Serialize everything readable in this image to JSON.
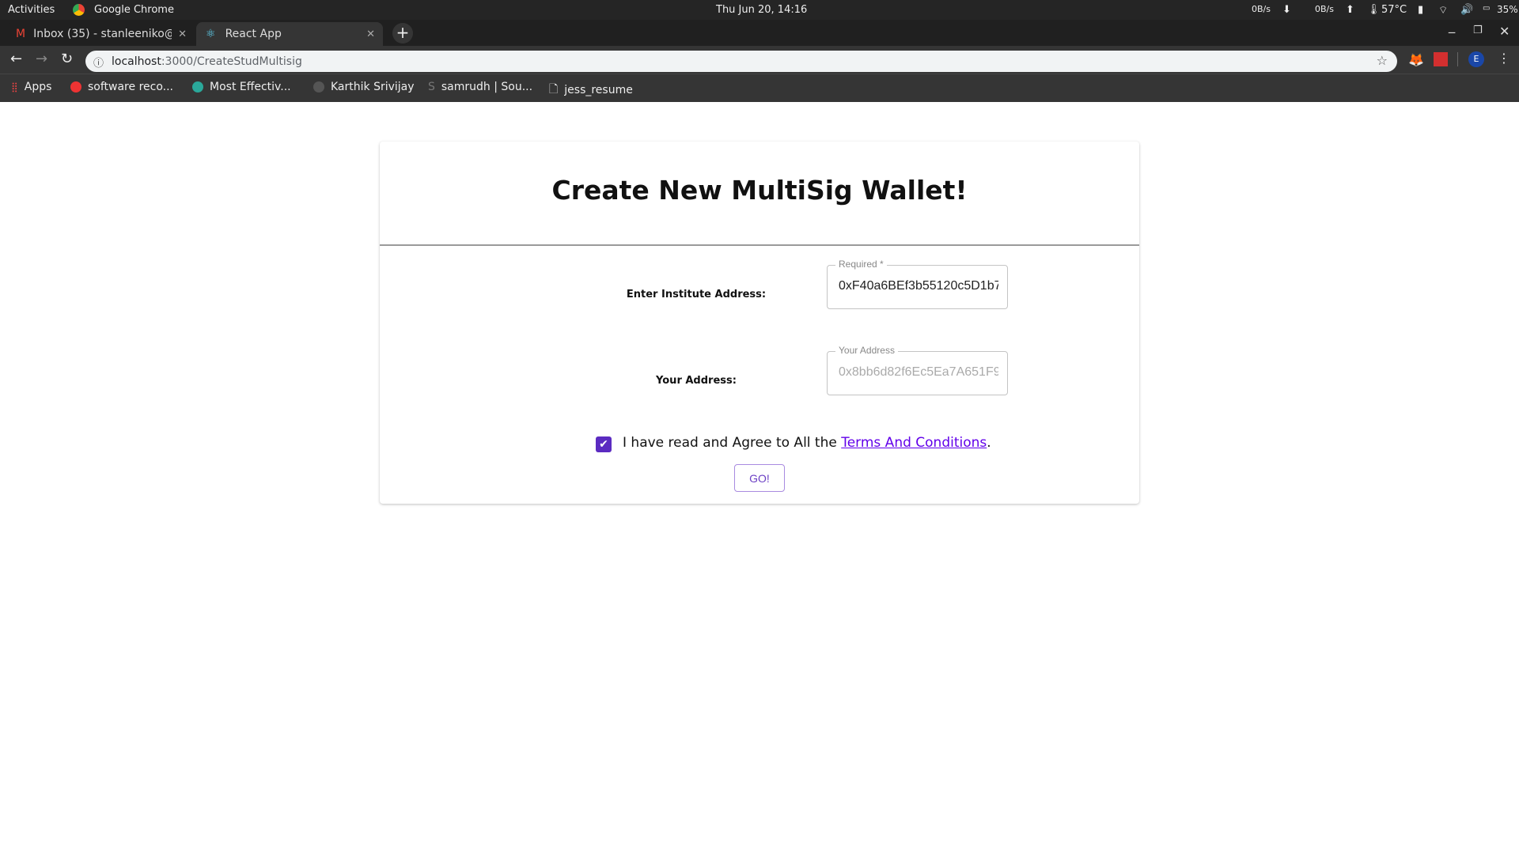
{
  "system_bar": {
    "activities": "Activities",
    "app": "Google Chrome",
    "clock": "Thu Jun 20, 14:16",
    "net_down": "0B/s",
    "net_up": "0B/s",
    "temp": "57°C",
    "battery": "35%"
  },
  "tabs": [
    {
      "label": "Inbox (35) - stanleeniko@",
      "icon": "gmail-icon",
      "active": false
    },
    {
      "label": "React App",
      "icon": "react-icon",
      "active": true
    }
  ],
  "address_bar": {
    "host": "localhost",
    "path": ":3000/CreateStudMultisig"
  },
  "profile_initial": "E",
  "bookmarks": [
    {
      "label": "Apps"
    },
    {
      "label": "software reco..."
    },
    {
      "label": "Most Effectiv..."
    },
    {
      "label": "Karthik Srivijay"
    },
    {
      "label": "samrudh | Sou..."
    },
    {
      "label": "jess_resume"
    }
  ],
  "form": {
    "title": "Create New MultiSig Wallet!",
    "institute_label": "Enter Institute Address:",
    "institute_legend": "Required *",
    "institute_value": "0xF40a6BEf3b55120c5D1b7",
    "your_label": "Your Address:",
    "your_legend": "Your Address",
    "your_value": "0x8bb6d82f6Ec5Ea7A651F9",
    "agree_checked": true,
    "agree_text": "I have read and Agree to All the ",
    "terms_link": "Terms And Conditions",
    "agree_end": ".",
    "go_label": "GO!"
  },
  "colors": {
    "accent": "#5b2bc1",
    "link": "#6200ea"
  }
}
